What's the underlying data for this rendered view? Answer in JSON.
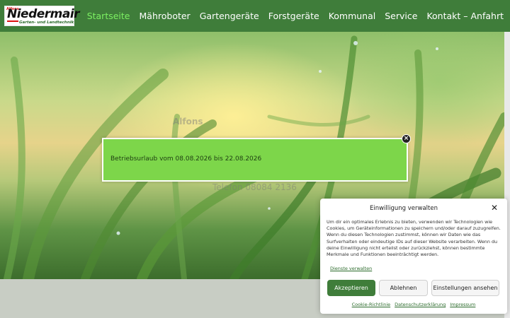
{
  "logo": {
    "small_text": "Alfons",
    "brand": "Niedermair",
    "tagline": "Garten- und Landtechnik"
  },
  "nav": {
    "items": [
      {
        "label": "Startseite",
        "active": true
      },
      {
        "label": "Mähroboter",
        "active": false
      },
      {
        "label": "Gartengeräte",
        "active": false
      },
      {
        "label": "Forstgeräte",
        "active": false
      },
      {
        "label": "Kommunal",
        "active": false
      },
      {
        "label": "Service",
        "active": false
      },
      {
        "label": "Kontakt – Anfahrt",
        "active": false
      }
    ]
  },
  "hero": {
    "faint_name": "Alfons",
    "faint_phone": "Telefon 08084 2136"
  },
  "notice": {
    "text": "Betriebsurlaub vom 08.08.2026 bis 22.08.2026",
    "close_symbol": "×"
  },
  "consent": {
    "title": "Einwilligung verwalten",
    "close_symbol": "✕",
    "body": "Um dir ein optimales Erlebnis zu bieten, verwenden wir Technologien wie Cookies, um Geräteinformationen zu speichern und/oder darauf zuzugreifen. Wenn du diesen Technologien zustimmst, können wir Daten wie das Surfverhalten oder eindeutige IDs auf dieser Website verarbeiten. Wenn du deine Einwilligung nicht erteilst oder zurückziehst, können bestimmte Merkmale und Funktionen beeinträchtigt werden.",
    "services_link": "Dienste verwalten",
    "accept_label": "Akzeptieren",
    "deny_label": "Ablehnen",
    "settings_label": "Einstellungen ansehen",
    "footer_links": [
      "Cookie-Richtlinie",
      "Datenschutzerklärung",
      "Impressum"
    ]
  },
  "colors": {
    "header_bg": "#3f7d3a",
    "nav_active": "#7cf062",
    "notice_bg": "#7dd64a",
    "accept_bg": "#3f7d3a"
  }
}
